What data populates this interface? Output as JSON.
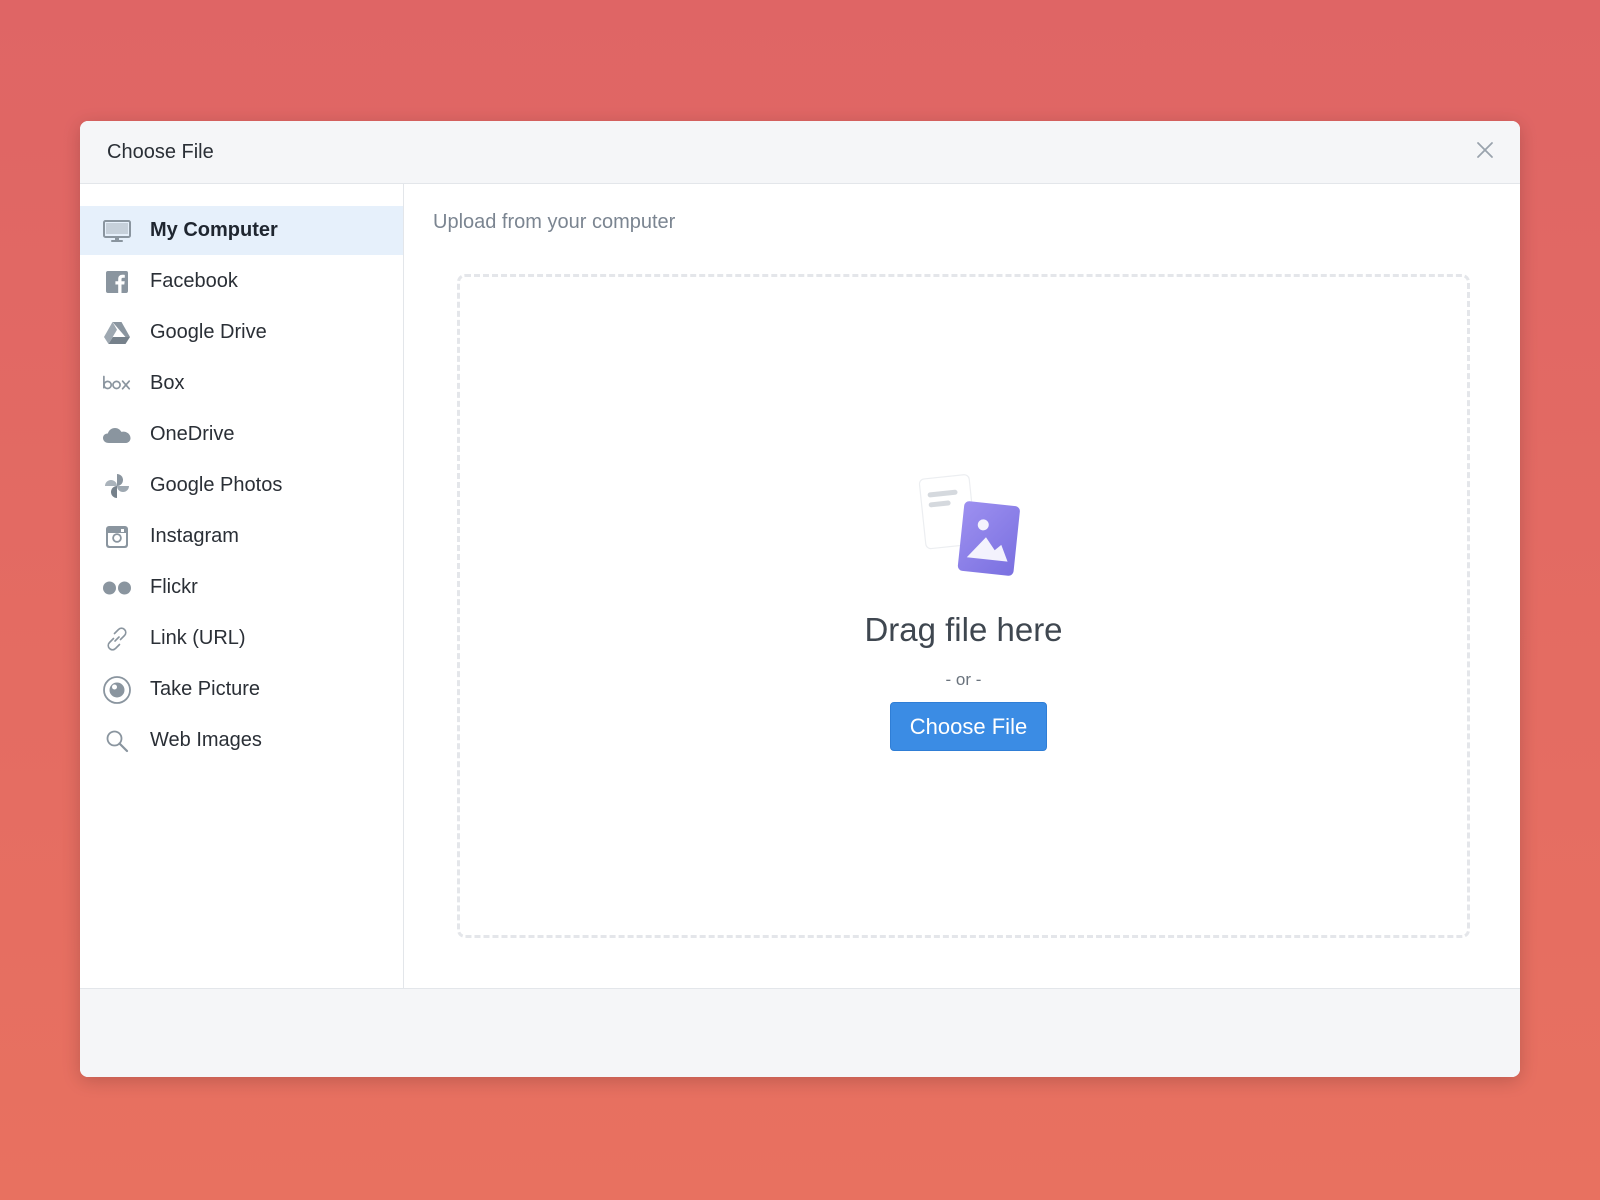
{
  "dialog": {
    "title": "Choose File",
    "close_icon": "close-icon"
  },
  "sidebar": {
    "items": [
      {
        "label": "My Computer",
        "icon": "monitor-icon",
        "active": true
      },
      {
        "label": "Facebook",
        "icon": "facebook-icon",
        "active": false
      },
      {
        "label": "Google Drive",
        "icon": "google-drive-icon",
        "active": false
      },
      {
        "label": "Box",
        "icon": "box-icon",
        "active": false
      },
      {
        "label": "OneDrive",
        "icon": "onedrive-icon",
        "active": false
      },
      {
        "label": "Google Photos",
        "icon": "google-photos-icon",
        "active": false
      },
      {
        "label": "Instagram",
        "icon": "instagram-icon",
        "active": false
      },
      {
        "label": "Flickr",
        "icon": "flickr-icon",
        "active": false
      },
      {
        "label": "Link (URL)",
        "icon": "link-icon",
        "active": false
      },
      {
        "label": "Take Picture",
        "icon": "camera-icon",
        "active": false
      },
      {
        "label": "Web Images",
        "icon": "search-icon",
        "active": false
      }
    ]
  },
  "main": {
    "title": "Upload from your computer",
    "dropzone": {
      "heading": "Drag file here",
      "separator": "- or -",
      "button_label": "Choose File",
      "illustration_icon": "file-image-illustration-icon"
    }
  },
  "colors": {
    "background": "#df6565",
    "accent": "#3b8ce4",
    "active_item_bg": "#e6f0fb",
    "icon_gray": "#8a959f",
    "illustration_purple": "#8b80e8"
  }
}
